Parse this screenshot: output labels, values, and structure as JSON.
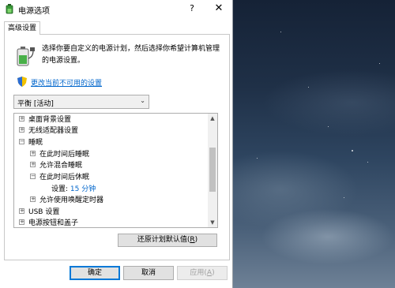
{
  "window": {
    "title": "电源选项",
    "help_label": "?",
    "close_label": "✕"
  },
  "tab": {
    "label": "高级设置"
  },
  "description": "选择你要自定义的电源计划，然后选择你希望计算机管理的电源设置。",
  "change_link": "更改当前不可用的设置",
  "plan_select": {
    "value": "平衡 [活动]"
  },
  "tree": {
    "items": [
      {
        "label": "桌面背景设置",
        "expander": "⊞"
      },
      {
        "label": "无线适配器设置",
        "expander": "⊞"
      },
      {
        "label": "睡眠",
        "expander": "⊟"
      },
      {
        "label": "在此时间后睡眠",
        "expander": "⊞"
      },
      {
        "label": "允许混合睡眠",
        "expander": "⊞"
      },
      {
        "label": "在此时间后休眠",
        "expander": "⊟"
      },
      {
        "label": "设置:",
        "value": "15 分钟"
      },
      {
        "label": "允许使用唤醒定时器",
        "expander": "⊞"
      },
      {
        "label": "USB 设置",
        "expander": "⊞"
      },
      {
        "label": "电源按钮和盖子",
        "expander": "⊞"
      }
    ]
  },
  "restore_button": {
    "label": "还原计划默认值(",
    "key": "R",
    "end": ")"
  },
  "buttons": {
    "ok": "确定",
    "cancel": "取消",
    "apply": "应用(",
    "apply_key": "A",
    "apply_end": ")"
  },
  "colors": {
    "link": "#0066cc",
    "accent": "#0078d7"
  }
}
